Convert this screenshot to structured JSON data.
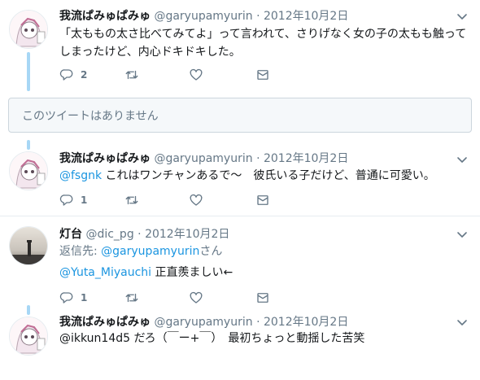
{
  "tweets": [
    {
      "name": "我流ぱみゅぱみゅ",
      "handle": "@garyupamyurin",
      "date": "2012年10月2日",
      "line1": "「太ももの太さ比べてみてよ」って言われて、さりげなく女の子の太もも触って",
      "line2": "しまったけど、内心ドキドキした。",
      "reply_count": "2"
    },
    {
      "name": "我流ぱみゅぱみゅ",
      "handle": "@garyupamyurin",
      "date": "2012年10月2日",
      "mention": "@fsgnk",
      "text": " これはワンチャンあるで～　彼氏いる子だけど、普通に可愛い。",
      "reply_count": "1"
    },
    {
      "name": "灯台",
      "handle": "@dic_pg",
      "date": "2012年10月2日",
      "replying_prefix": "返信先: ",
      "replying_to": "@garyupamyurin",
      "replying_suffix": "さん",
      "mention": "@Yuta_Miyauchi",
      "text": " 正直羨ましい←",
      "reply_count": "1"
    },
    {
      "name": "我流ぱみゅぱみゅ",
      "handle": "@garyupamyurin",
      "date": "2012年10月2日",
      "text": "@ikkun14d5 だろ（￣ー+￣）　最初ちょっと動揺した苦笑"
    }
  ],
  "separator": "·",
  "unavailable_text": "このツイートはありません",
  "colors": {
    "accent": "#1b95e0",
    "thread_line": "#a7d7f5",
    "muted": "#657786"
  },
  "icons": [
    "reply-icon",
    "retweet-icon",
    "like-icon",
    "dm-icon",
    "caret-down-icon"
  ]
}
